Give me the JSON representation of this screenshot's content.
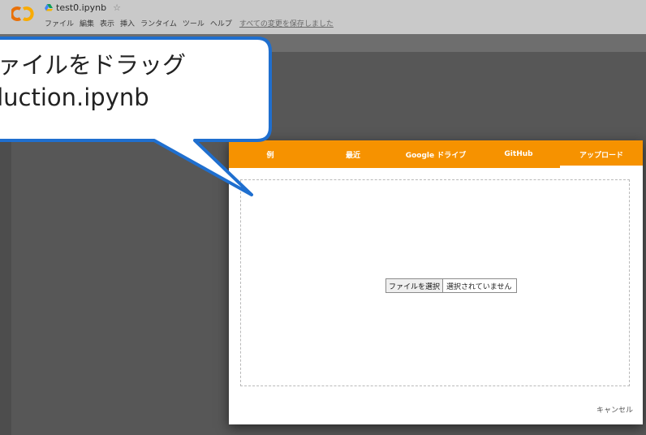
{
  "app": {
    "filename": "test0.ipynb",
    "menu": [
      "ファイル",
      "編集",
      "表示",
      "挿入",
      "ランタイム",
      "ツール",
      "ヘルプ"
    ],
    "save_status": "すべての変更を保存しました"
  },
  "dialog": {
    "tabs": [
      "例",
      "最近",
      "Google ドライブ",
      "GitHub",
      "アップロード"
    ],
    "active_tab": "アップロード",
    "file_button": "ファイルを選択",
    "file_status": "選択されていません",
    "cancel": "キャンセル"
  },
  "callout": {
    "line1": "ファイルをドラッグ",
    "line2": "oduction.ipynb"
  },
  "colors": {
    "accent": "#f69200",
    "callout_border": "#1f6fcf"
  }
}
